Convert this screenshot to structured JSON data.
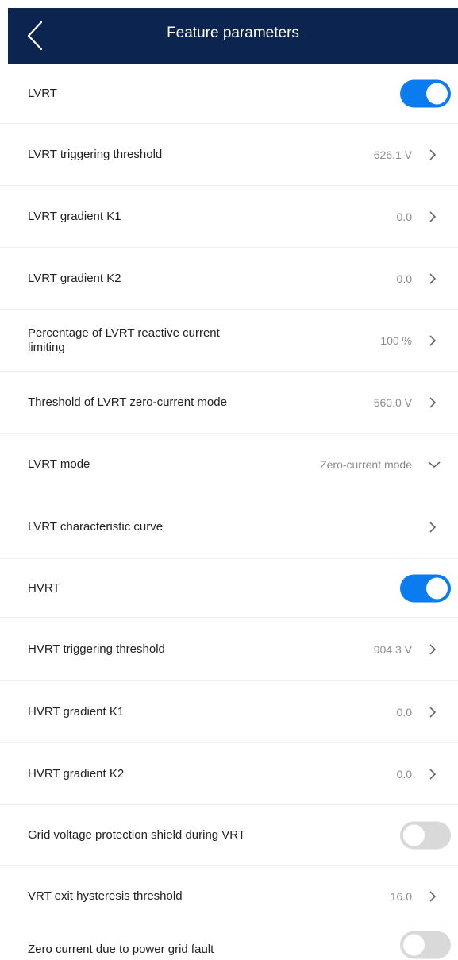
{
  "header": {
    "title": "Feature parameters",
    "back_icon": "chevron-left-icon",
    "background_color": "#0b2550"
  },
  "accent_color": "#0a7cf0",
  "rows": [
    {
      "label": "LVRT",
      "type": "toggle",
      "on": true
    },
    {
      "label": "LVRT triggering threshold",
      "type": "value",
      "value": "626.1 V"
    },
    {
      "label": "LVRT gradient K1",
      "type": "value",
      "value": "0.0"
    },
    {
      "label": "LVRT gradient K2",
      "type": "value",
      "value": "0.0"
    },
    {
      "label": "Percentage of LVRT reactive current limiting",
      "type": "value",
      "value": "100 %"
    },
    {
      "label": "Threshold of LVRT zero-current mode",
      "type": "value",
      "value": "560.0 V"
    },
    {
      "label": "LVRT mode",
      "type": "select",
      "value": "Zero-current mode"
    },
    {
      "label": "LVRT characteristic curve",
      "type": "link",
      "value": ""
    },
    {
      "label": "HVRT",
      "type": "toggle",
      "on": true
    },
    {
      "label": "HVRT triggering threshold",
      "type": "value",
      "value": "904.3 V"
    },
    {
      "label": "HVRT gradient K1",
      "type": "value",
      "value": "0.0"
    },
    {
      "label": "HVRT gradient K2",
      "type": "value",
      "value": "0.0"
    },
    {
      "label": "Grid voltage protection shield during VRT",
      "type": "toggle",
      "on": false
    },
    {
      "label": "VRT exit hysteresis threshold",
      "type": "value",
      "value": "16.0"
    },
    {
      "label": "Zero current due to power grid fault",
      "type": "toggle",
      "on": false
    }
  ]
}
